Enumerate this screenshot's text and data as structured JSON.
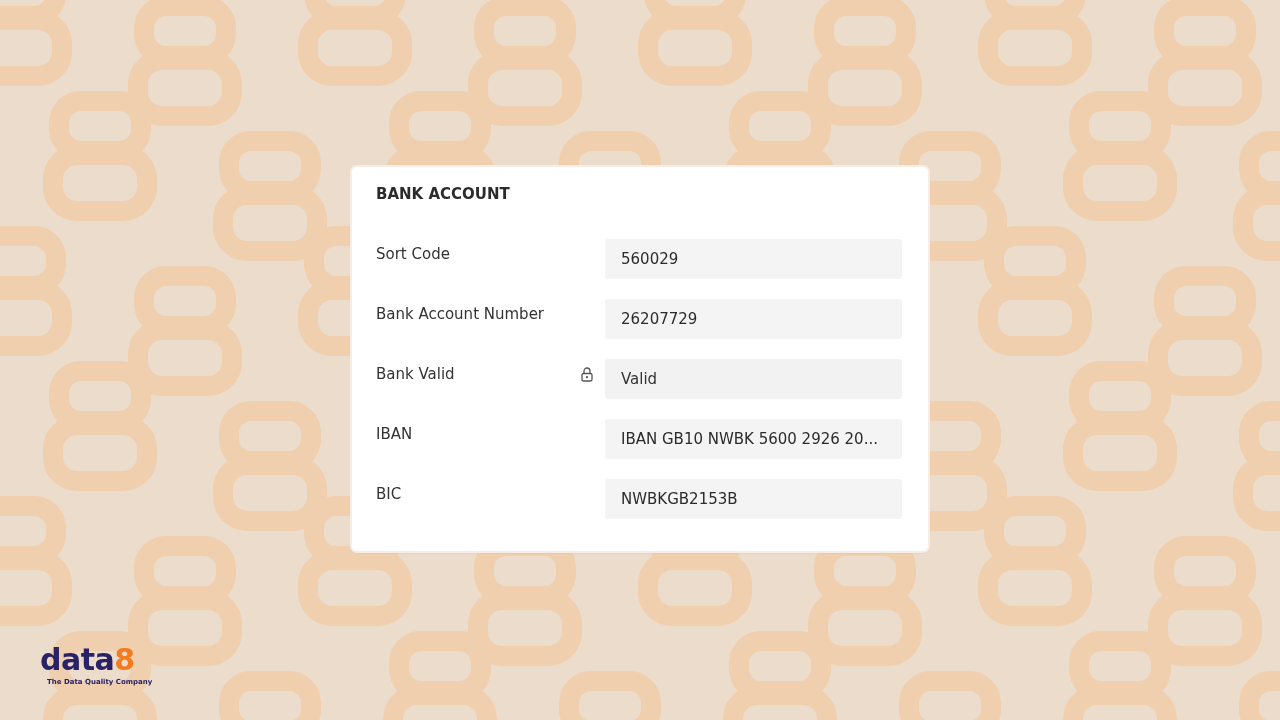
{
  "card": {
    "title": "BANK ACCOUNT",
    "fields": [
      {
        "label": "Sort Code",
        "value": "560029",
        "locked": false
      },
      {
        "label": "Bank Account Number",
        "value": "26207729",
        "locked": false
      },
      {
        "label": "Bank Valid",
        "value": "Valid",
        "locked": true
      },
      {
        "label": "IBAN",
        "value": "IBAN GB10 NWBK 5600 2926 20...",
        "locked": false
      },
      {
        "label": "BIC",
        "value": "NWBKGB2153B",
        "locked": false
      }
    ]
  },
  "logo": {
    "name": [
      "data",
      "8"
    ],
    "tagline": "The Data Quality Company"
  }
}
